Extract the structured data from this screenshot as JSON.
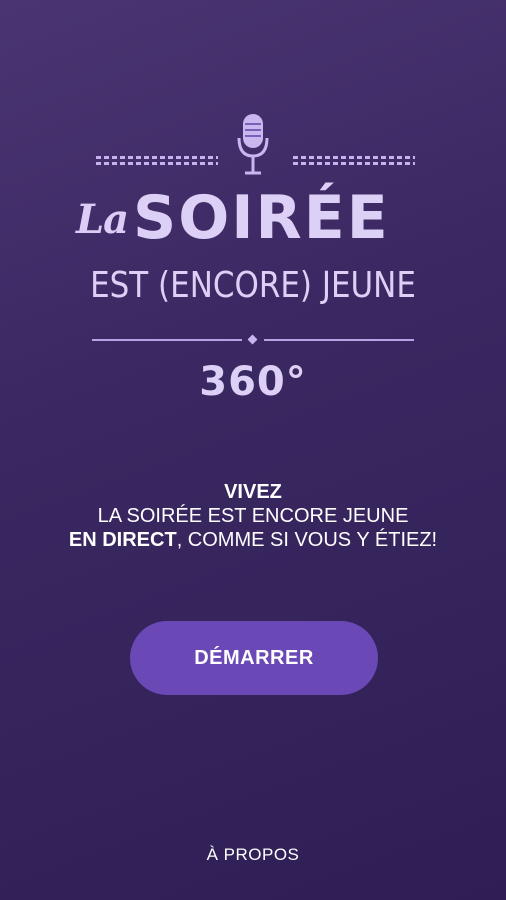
{
  "logo": {
    "title_la": "La",
    "title_main": "SOIRÉE",
    "title_sub": "EST (ENCORE) JEUNE",
    "title_360": "360°",
    "icons": [
      "microphone-icon",
      "dashed-ornament",
      "diamond-divider"
    ],
    "colors": {
      "logo_text": "#ddd0f7",
      "ornament": "#c6b3ee"
    }
  },
  "tagline": {
    "line1": "VIVEZ",
    "line2": "LA SOIRÉE EST ENCORE JEUNE",
    "line3_strong": "EN DIRECT",
    "line3_rest": ", COMME SI VOUS Y ÉTIEZ!"
  },
  "actions": {
    "start_label": "DÉMARRER",
    "about_label": "À PROPOS"
  },
  "colors": {
    "background_top": "#4a3572",
    "background_bottom": "#2f1e55",
    "button": "#6a48b6",
    "text": "#ffffff"
  }
}
